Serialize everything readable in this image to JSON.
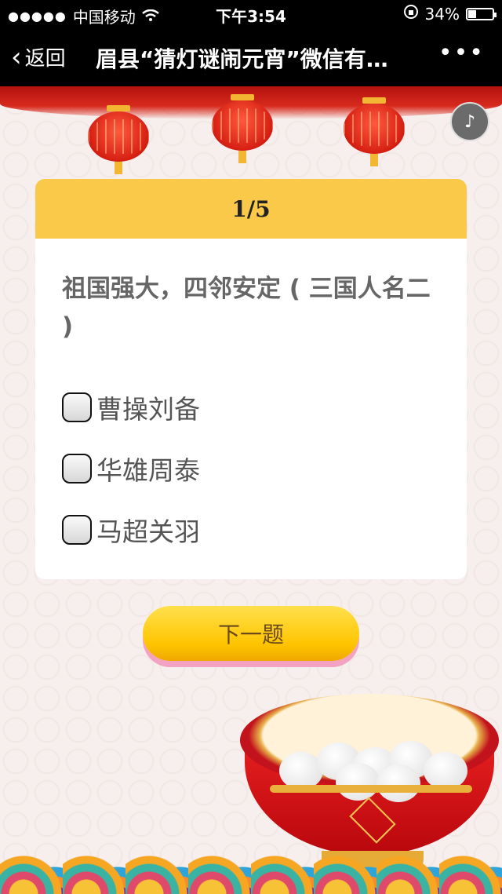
{
  "status_bar": {
    "signal": "●●●●●",
    "carrier": "中国移动",
    "time": "下午3:54",
    "battery_text": "34%",
    "battery_level": 0.34
  },
  "nav": {
    "back_label": "返回",
    "title": "眉县“猜灯谜闹元宵”微信有…",
    "more_label": "•••"
  },
  "quiz": {
    "progress": "1/5",
    "question": "祖国强大，四邻安定 ( 三国人名二 )",
    "options": [
      "曹操刘备",
      "华雄周泰",
      "马超关羽"
    ],
    "next_label": "下一题"
  },
  "colors": {
    "header_yellow": "#fbc949",
    "button_yellow": "#ffc400",
    "nav_black": "#000000"
  }
}
